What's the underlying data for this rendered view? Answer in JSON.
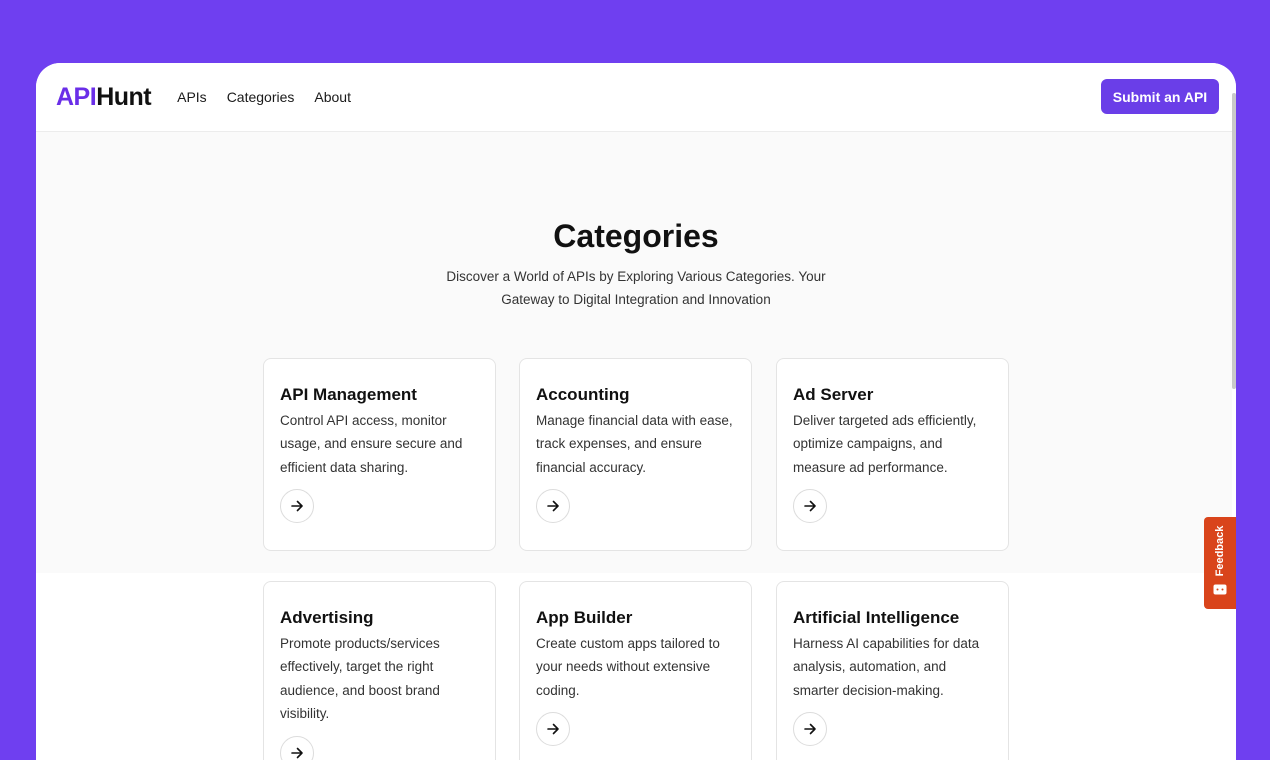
{
  "header": {
    "logo_accent": "API",
    "logo_rest": "Hunt",
    "nav": [
      {
        "label": "APIs"
      },
      {
        "label": "Categories"
      },
      {
        "label": "About"
      }
    ],
    "submit_label": "Submit an API"
  },
  "hero": {
    "title": "Categories",
    "subtitle": "Discover a World of APIs by Exploring Various Categories. Your Gateway to Digital Integration and Innovation"
  },
  "categories": [
    {
      "title": "API Management",
      "description": "Control API access, monitor usage, and ensure secure and efficient data sharing."
    },
    {
      "title": "Accounting",
      "description": "Manage financial data with ease, track expenses, and ensure financial accuracy."
    },
    {
      "title": "Ad Server",
      "description": "Deliver targeted ads efficiently, optimize campaigns, and measure ad performance."
    },
    {
      "title": "Advertising",
      "description": "Promote products/services effectively, target the right audience, and boost brand visibility."
    },
    {
      "title": "App Builder",
      "description": "Create custom apps tailored to your needs without extensive coding."
    },
    {
      "title": "Artificial Intelligence",
      "description": "Harness AI capabilities for data analysis, automation, and smarter decision-making."
    }
  ],
  "feedback": {
    "label": "Feedback"
  },
  "colors": {
    "background": "#6f3ff0",
    "accent": "#6a2ee8",
    "button": "#6a3ee8",
    "feedback": "#d9441b"
  }
}
